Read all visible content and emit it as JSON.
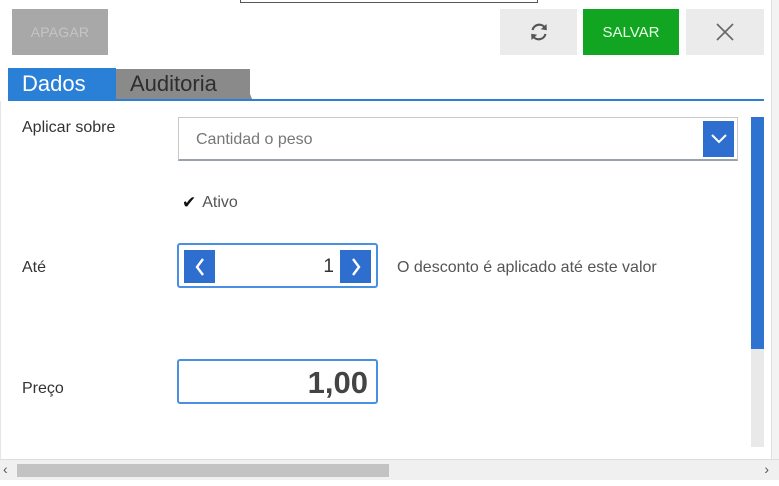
{
  "toolbar": {
    "delete_label": "APAGAR",
    "save_label": "SALVAR",
    "refresh_icon": "refresh-icon",
    "close_icon": "close-icon"
  },
  "tabs": [
    {
      "label": "Dados",
      "active": true
    },
    {
      "label": "Auditoria",
      "active": false
    }
  ],
  "form": {
    "apply_on": {
      "label": "Aplicar sobre",
      "value": "Cantidad o peso"
    },
    "active": {
      "label": "Ativo",
      "checked": true
    },
    "until": {
      "label": "Até",
      "value": "1",
      "hint": "O desconto é aplicado até este valor"
    },
    "price": {
      "label": "Preço",
      "value": "1,00"
    }
  },
  "colors": {
    "accent": "#2e6ecf",
    "save": "#11a521",
    "tab_active": "#2a7fd6",
    "tab_inactive": "#8a8a8a"
  }
}
